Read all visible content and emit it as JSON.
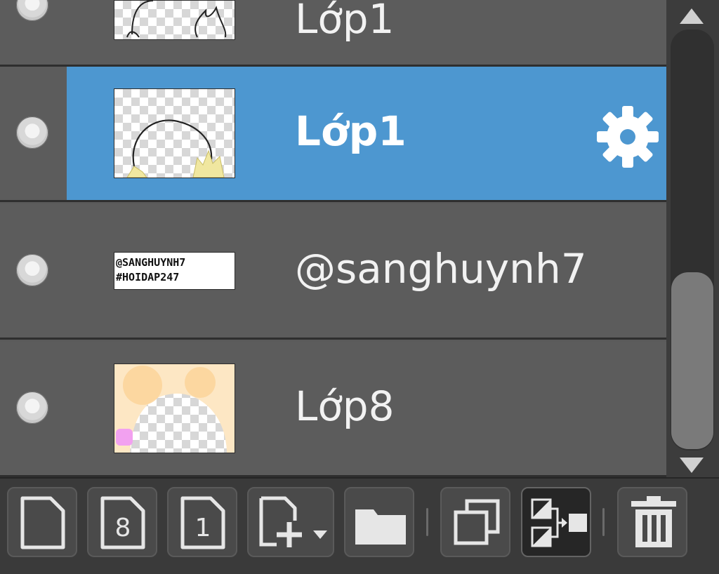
{
  "layers": [
    {
      "name": "Lớp1",
      "selected": false,
      "partial": true
    },
    {
      "name": "Lớp1",
      "selected": true
    },
    {
      "name": "@sanghuynh7",
      "selected": false,
      "thumb_text": [
        "@SANGHUYNH7",
        "#HOIDAP247"
      ]
    },
    {
      "name": "Lớp8",
      "selected": false
    }
  ],
  "badge_numbers": {
    "raster_8bit": "8",
    "raster_1bit": "1"
  },
  "toolbar": [
    {
      "icon": "new-layer-icon"
    },
    {
      "icon": "new-8bit-layer-icon"
    },
    {
      "icon": "new-1bit-layer-icon"
    },
    {
      "icon": "add-layer-dropdown-icon"
    },
    {
      "icon": "folder-icon"
    },
    {
      "icon": "duplicate-layer-icon"
    },
    {
      "icon": "transfer-layer-icon"
    },
    {
      "icon": "trash-icon"
    }
  ],
  "colors": {
    "selected": "#4d97d0",
    "row": "#5c5c5c",
    "panel": "#3a3a3a"
  }
}
